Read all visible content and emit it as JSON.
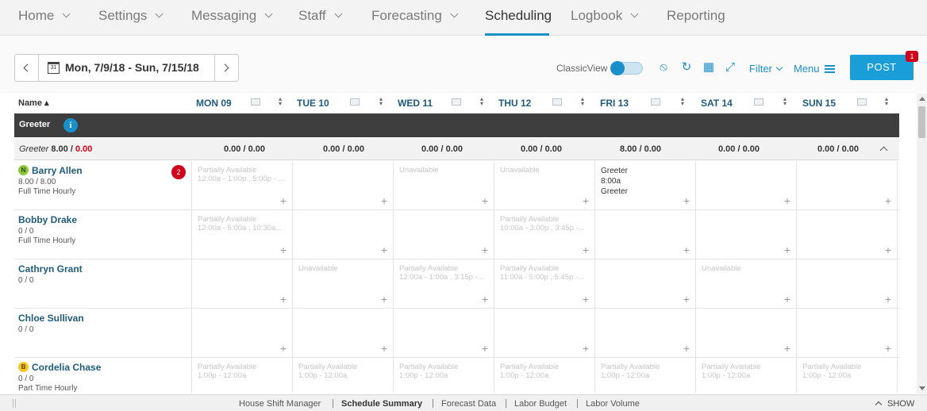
{
  "nav": {
    "items": [
      {
        "label": "Home",
        "chevron": true
      },
      {
        "label": "Settings",
        "chevron": true
      },
      {
        "label": "Messaging",
        "chevron": true
      },
      {
        "label": "Staff",
        "chevron": true
      },
      {
        "label": "Forecasting",
        "chevron": true
      },
      {
        "label": "Scheduling",
        "chevron": false,
        "active": true
      },
      {
        "label": "Logbook",
        "chevron": true
      },
      {
        "label": "Reporting",
        "chevron": false
      }
    ]
  },
  "toolbar": {
    "date_range": "Mon, 7/9/18 - Sun, 7/15/18",
    "calendar_day": "31",
    "classic_view_label": "ClassicView",
    "filter_label": "Filter",
    "menu_label": "Menu",
    "post_label": "POST",
    "post_badge": "1",
    "accent_color": "#1a8fc9"
  },
  "grid": {
    "name_header": "Name ▴",
    "days": [
      "MON 09",
      "TUE 10",
      "WED 11",
      "THU 12",
      "FRI 13",
      "SAT 14",
      "SUN 15"
    ],
    "section": {
      "title": "Greeter",
      "info_icon": "i",
      "totals_label": "Greeter",
      "totals_scheduled": "8.00",
      "totals_sep": " / ",
      "totals_over": "0.00",
      "day_totals": [
        "0.00 / 0.00",
        "0.00 / 0.00",
        "0.00 / 0.00",
        "0.00 / 0.00",
        "8.00 / 0.00",
        "0.00 / 0.00",
        "0.00 / 0.00"
      ]
    },
    "employees": [
      {
        "name": "Barry Allen",
        "badge": "N",
        "hours": "8.00 / 8.00",
        "type": "Full Time Hourly",
        "notifications": "2",
        "cells": [
          {
            "avail": "Partially Available",
            "avail2": "12:00a - 1:00p , 5:00p - ..."
          },
          {},
          {
            "avail": "Unavailable"
          },
          {
            "avail": "Unavailable"
          },
          {
            "shift_role": "Greeter",
            "shift_time": "8:00a",
            "shift_role2": "Greeter"
          },
          {},
          {}
        ]
      },
      {
        "name": "Bobby Drake",
        "hours": "0 / 0",
        "type": "Full Time Hourly",
        "cells": [
          {
            "avail": "Partially Available",
            "avail2": "12:00a - 5:00a , 10:30a..."
          },
          {},
          {},
          {
            "avail": "Partially Available",
            "avail2": "10:00a - 3:00p , 3:45p -..."
          },
          {},
          {},
          {}
        ]
      },
      {
        "name": "Cathryn Grant",
        "hours": "0 / 0",
        "type": "",
        "cells": [
          {},
          {
            "avail": "Unavailable"
          },
          {
            "avail": "Partially Available",
            "avail2": "12:00a - 1:00a , 3:15p -..."
          },
          {
            "avail": "Partially Available",
            "avail2": "11:00a - 5:00p , 5:45p -..."
          },
          {},
          {
            "avail": "Unavailable"
          },
          {}
        ]
      },
      {
        "name": "Chloe Sullivan",
        "hours": "0 / 0",
        "type": "",
        "cells": [
          {},
          {},
          {},
          {},
          {},
          {},
          {}
        ]
      },
      {
        "name": "Cordelia Chase",
        "badge": "B",
        "hours": "0 / 0",
        "type": "Part Time Hourly",
        "cells": [
          {
            "avail": "Partially Available",
            "avail2": "1:00p - 12:00a"
          },
          {
            "avail": "Partially Available",
            "avail2": "1:00p - 12:00a"
          },
          {
            "avail": "Partially Available",
            "avail2": "1:00p - 12:00a"
          },
          {
            "avail": "Partially Available",
            "avail2": "1:00p - 12:00a"
          },
          {
            "avail": "Partially Available",
            "avail2": "1:00p - 12:00a"
          },
          {
            "avail": "Partially Available",
            "avail2": "1:00p - 12:00a"
          },
          {
            "avail": "Partially Available",
            "avail2": "1:00p - 12:00a"
          }
        ]
      }
    ]
  },
  "footer": {
    "links": [
      "House Shift Manager",
      "Schedule Summary",
      "Forecast Data",
      "Labor Budget",
      "Labor Volume"
    ],
    "show_label": "SHOW"
  }
}
